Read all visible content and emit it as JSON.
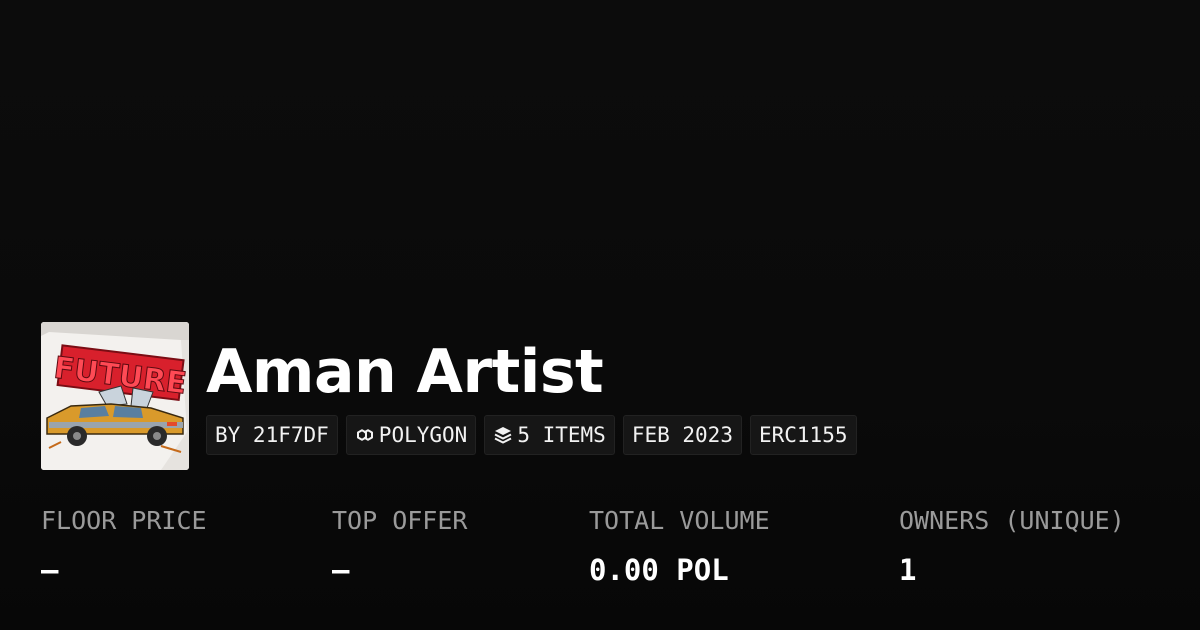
{
  "collection": {
    "name": "Aman Artist",
    "chips": [
      {
        "icon": "",
        "label": "BY 21F7DF"
      },
      {
        "icon": "polygon-icon",
        "label": "POLYGON"
      },
      {
        "icon": "layers-icon",
        "label": "5 ITEMS"
      },
      {
        "icon": "",
        "label": "FEB 2023"
      },
      {
        "icon": "",
        "label": "ERC1155"
      }
    ],
    "avatar_text": "FUTURE"
  },
  "stats": [
    {
      "label": "FLOOR PRICE",
      "value": "–"
    },
    {
      "label": "TOP OFFER",
      "value": "–"
    },
    {
      "label": "TOTAL VOLUME",
      "value": "0.00 POL"
    },
    {
      "label": "OWNERS (UNIQUE)",
      "value": "1"
    }
  ],
  "colors": {
    "background": "#0a0a0a",
    "chip_background": "#161616",
    "label_gray": "#9a9a9a",
    "text": "#ffffff"
  }
}
